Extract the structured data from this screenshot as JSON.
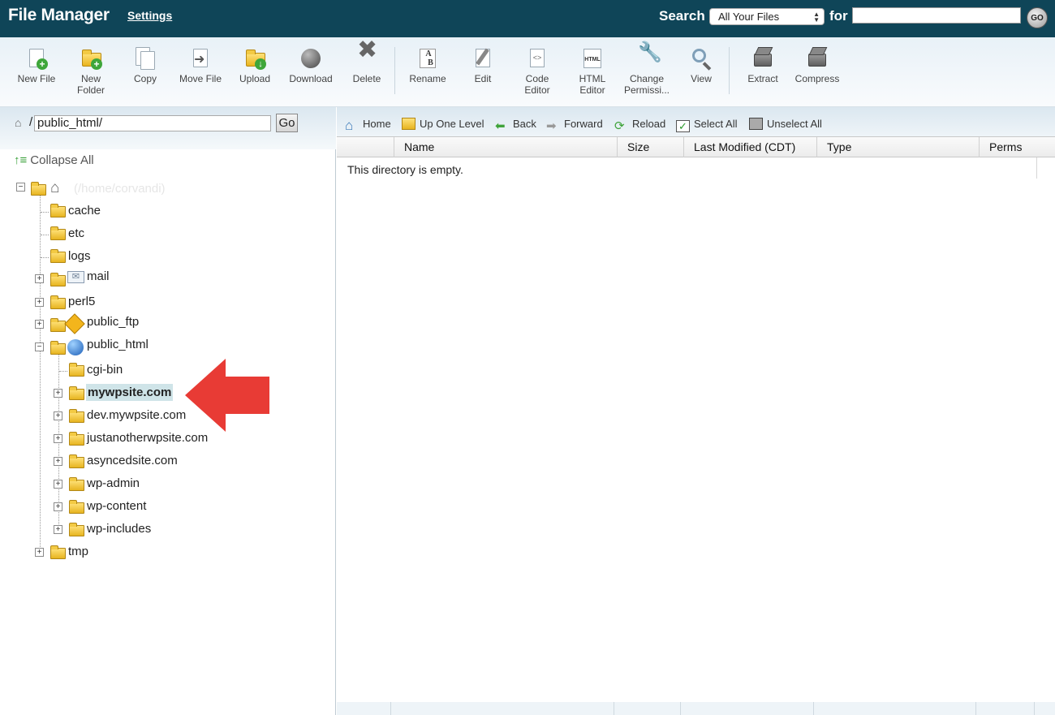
{
  "header": {
    "title": "File Manager",
    "settings_label": "Settings",
    "search_label": "Search",
    "search_scope": "All Your Files",
    "for_label": "for",
    "search_query": "",
    "go_label": "GO",
    "bg_color": "#0f4558"
  },
  "toolbar": {
    "new_file": "New File",
    "new_folder_1": "New",
    "new_folder_2": "Folder",
    "copy": "Copy",
    "move_file": "Move File",
    "upload": "Upload",
    "download": "Download",
    "delete": "Delete",
    "rename": "Rename",
    "edit": "Edit",
    "code_editor_1": "Code",
    "code_editor_2": "Editor",
    "html_editor_1": "HTML",
    "html_editor_2": "Editor",
    "change_perms_1": "Change",
    "change_perms_2": "Permissi...",
    "view": "View",
    "extract": "Extract",
    "compress": "Compress"
  },
  "left": {
    "path_slash": "/",
    "path_value": "public_html/",
    "go_label": "Go",
    "collapse_all": "Collapse All",
    "root_label": "(/home/corvandi)",
    "tree": {
      "cache": "cache",
      "etc": "etc",
      "logs": "logs",
      "mail": "mail",
      "perl5": "perl5",
      "public_ftp": "public_ftp",
      "public_html": "public_html",
      "cgi_bin": "cgi-bin",
      "mywpsite": "mywpsite.com",
      "dev_mywpsite": "dev.mywpsite.com",
      "justanother": "justanotherwpsite.com",
      "asynced": "asyncedsite.com",
      "wp_admin": "wp-admin",
      "wp_content": "wp-content",
      "wp_includes": "wp-includes",
      "tmp": "tmp"
    },
    "selected_highlight_color": "#cfe4e8",
    "annotation_arrow_color": "#e83b35"
  },
  "right": {
    "nav": {
      "home": "Home",
      "up_one_level": "Up One Level",
      "back": "Back",
      "forward": "Forward",
      "reload": "Reload",
      "select_all": "Select All",
      "unselect_all": "Unselect All"
    },
    "columns": {
      "name": "Name",
      "size": "Size",
      "last_modified": "Last Modified (CDT)",
      "type": "Type",
      "perms": "Perms"
    },
    "empty_message": "This directory is empty."
  }
}
